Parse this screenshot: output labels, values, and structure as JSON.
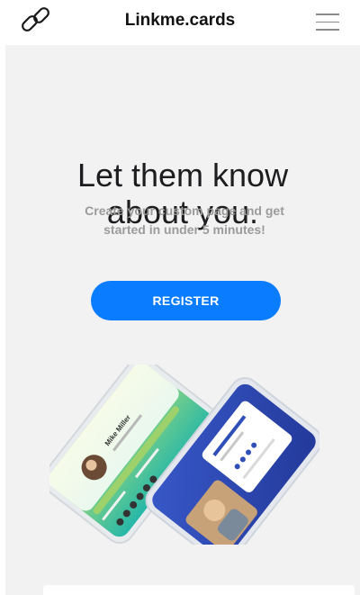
{
  "header": {
    "brand": "Linkme.cards",
    "logo_icon": "chain-link-icon",
    "menu_icon": "hamburger-menu-icon"
  },
  "hero": {
    "headline_line1": "Let them know",
    "headline_line2": "about you.",
    "subtext_line1": "Create your custom page and get",
    "subtext_line2": "started in under 5 minutes!",
    "register_label": "REGISTER"
  },
  "illustration": {
    "name": "two-phone-mockup",
    "profile_name": "Mike Miller"
  },
  "colors": {
    "accent": "#0a7cff",
    "background": "#f2f2f3",
    "subtext": "#9b9b9b",
    "phone_left_gradient": [
      "#b9e26a",
      "#2fb9a6"
    ],
    "phone_right": "#2f4fb8"
  }
}
